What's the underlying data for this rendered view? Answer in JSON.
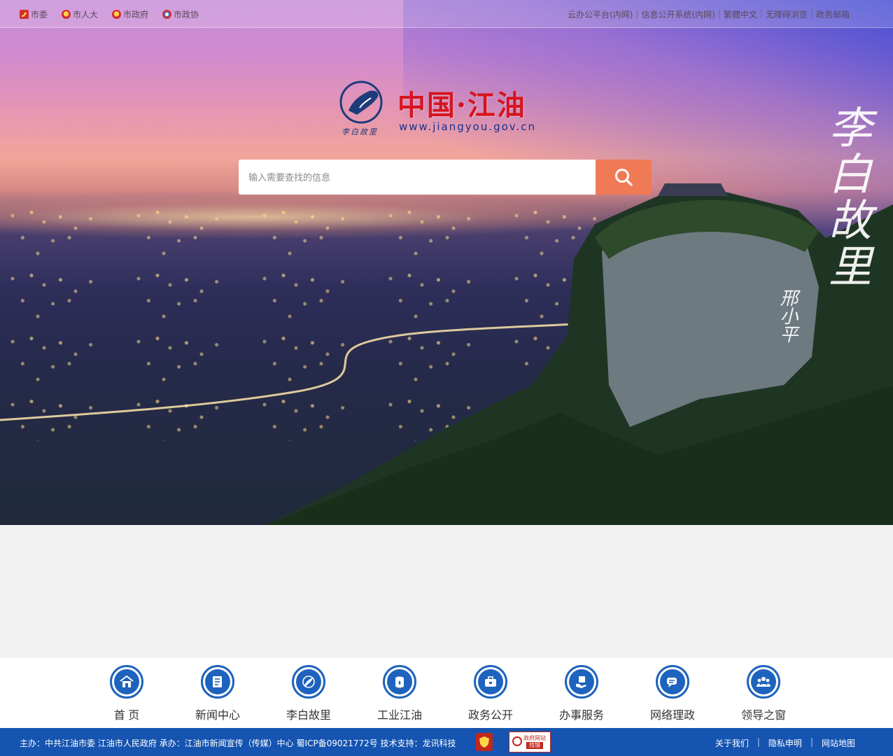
{
  "topbar": {
    "left_links": [
      {
        "label": "市委",
        "icon": "party-emblem-icon"
      },
      {
        "label": "市人大",
        "icon": "national-emblem-icon"
      },
      {
        "label": "市政府",
        "icon": "national-emblem-icon"
      },
      {
        "label": "市政协",
        "icon": "cppcc-emblem-icon"
      }
    ],
    "right_links": [
      "云办公平台(内网)",
      "信息公开系统(内网)",
      "繁體中文",
      "无障碍浏览",
      "政务邮箱"
    ],
    "separator": "|"
  },
  "logo": {
    "title": "中国·江油",
    "url": "www.jiangyou.gov.cn",
    "script": "李白故里"
  },
  "search": {
    "placeholder": "输入需要查找的信息",
    "button_color": "#f07a55"
  },
  "calligraphy": {
    "text": "李白故里",
    "signature": "邢小平"
  },
  "nav": {
    "accent": "#1e63bd",
    "items": [
      {
        "label": "首 页",
        "icon": "home-icon"
      },
      {
        "label": "新闻中心",
        "icon": "news-icon"
      },
      {
        "label": "李白故里",
        "icon": "libai-icon"
      },
      {
        "label": "工业江油",
        "icon": "industry-icon"
      },
      {
        "label": "政务公开",
        "icon": "briefcase-icon"
      },
      {
        "label": "办事服务",
        "icon": "service-icon"
      },
      {
        "label": "网络理政",
        "icon": "chat-icon"
      },
      {
        "label": "领导之窗",
        "icon": "leaders-icon"
      }
    ]
  },
  "footer": {
    "info": "主办：中共江油市委 江油市人民政府   承办：江油市新闻宣传（传媒）中心   蜀ICP备09021772号   技术支持：龙讯科技",
    "badge_text_1": "政府网站",
    "badge_text_2": "找错",
    "links": [
      "关于我们",
      "隐私申明",
      "网站地图"
    ],
    "background": "#1554b0"
  }
}
